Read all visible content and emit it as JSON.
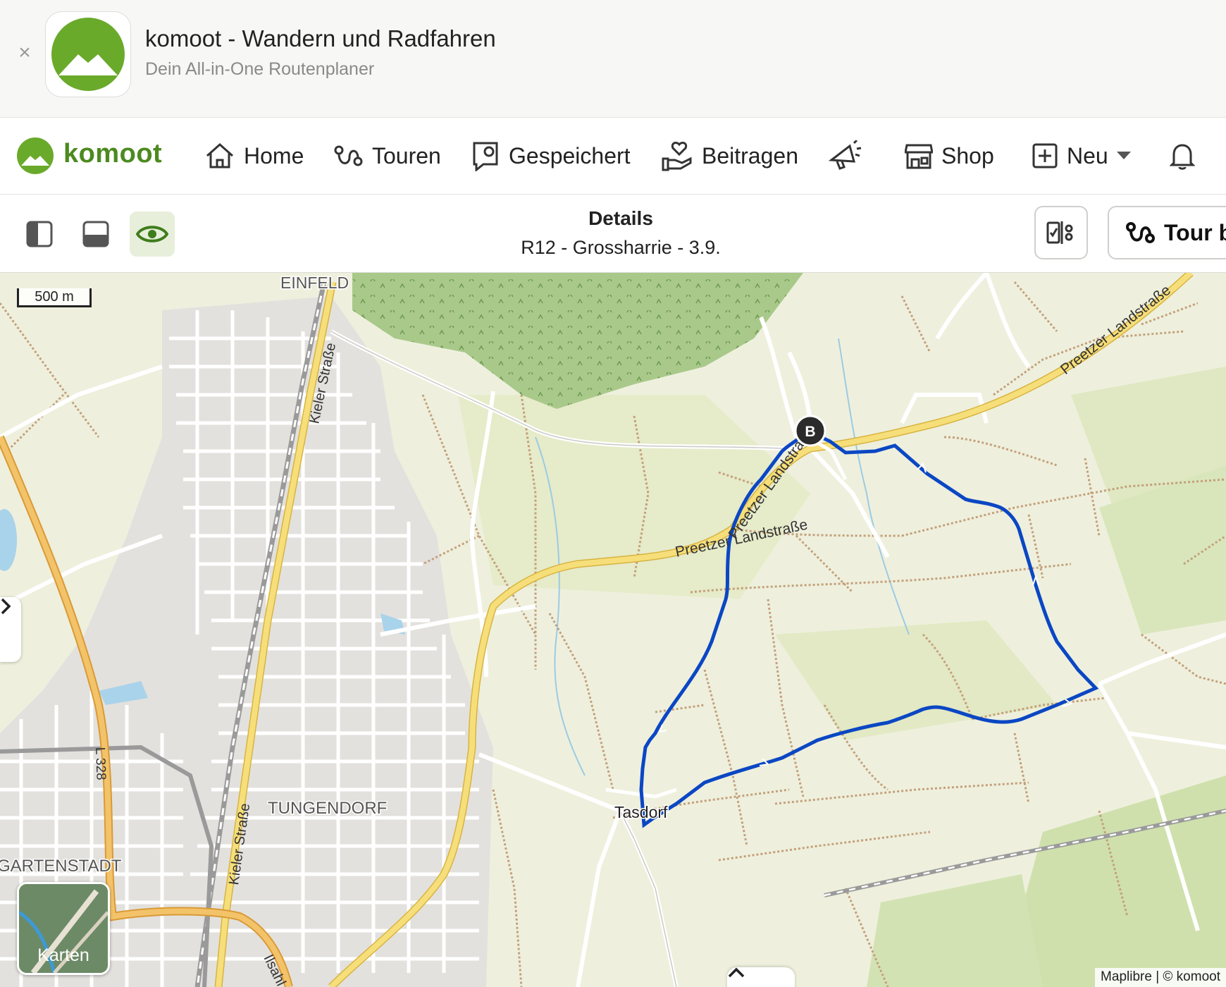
{
  "banner": {
    "close_icon": "close-icon",
    "app_title": "komoot - Wandern und Radfahren",
    "app_subtitle": "Dein All-in-One Routenplaner"
  },
  "nav": {
    "logo_text": "komoot",
    "items": [
      {
        "label": "Home",
        "icon": "house-icon"
      },
      {
        "label": "Touren",
        "icon": "route-icon"
      },
      {
        "label": "Gespeichert",
        "icon": "bookmark-icon"
      },
      {
        "label": "Beitragen",
        "icon": "heart-hand-icon"
      },
      {
        "label": "",
        "icon": "megaphone-icon"
      },
      {
        "label": "Shop",
        "icon": "store-icon"
      },
      {
        "label": "Neu",
        "icon": "plus-square-icon"
      }
    ],
    "bell_icon": "bell-icon",
    "accent": "#4c8a1f"
  },
  "detailbar": {
    "title": "Details",
    "subtitle": "R12 - Grossharrie - 3.9.",
    "tour_button": "Tour b"
  },
  "map": {
    "scale": "500 m",
    "layer_button": "Karten",
    "attribution": "Maplibre | © komoot",
    "marker": "B",
    "route_color": "#0b47c4",
    "places": [
      "EINFELD",
      "TUNGENDORF",
      "GARTENSTADT",
      "Tasdorf"
    ],
    "road_labels": [
      "Kieler Straße",
      "Kieler Straße",
      "Preetzer Landstraße",
      "Preetzer Landstraße",
      "Preetzer Landstraße",
      "L 328",
      "Ilsahl"
    ]
  }
}
